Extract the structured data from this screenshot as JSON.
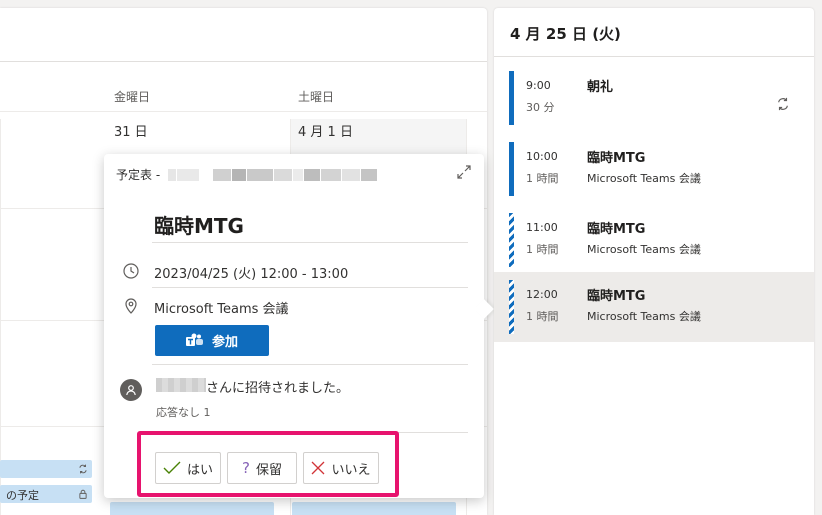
{
  "calendar": {
    "day_headers": [
      "金曜日",
      "土曜日"
    ],
    "dates": [
      "31 日",
      "4 月 1 日"
    ],
    "chip_label": "の予定"
  },
  "popup": {
    "header_label": "予定表 -",
    "title": "臨時MTG",
    "datetime": "2023/04/25 (火) 12:00 - 13:00",
    "location": "Microsoft Teams 会議",
    "join_label": "参加",
    "invite_text": "さんに招待されました。",
    "response_summary": "応答なし 1",
    "buttons": {
      "yes": "はい",
      "maybe": "保留",
      "no": "いいえ"
    },
    "colors": {
      "accent": "#0f6cbd",
      "highlight": "#e7136e"
    }
  },
  "agenda": {
    "date_heading": "4 月 25 日 (火)",
    "events": [
      {
        "time": "9:00",
        "duration": "30 分",
        "title": "朝礼",
        "location": "",
        "style": "solid",
        "recurring": true,
        "selected": false
      },
      {
        "time": "10:00",
        "duration": "1 時間",
        "title": "臨時MTG",
        "location": "Microsoft Teams 会議",
        "style": "solid",
        "recurring": false,
        "selected": false
      },
      {
        "time": "11:00",
        "duration": "1 時間",
        "title": "臨時MTG",
        "location": "Microsoft Teams 会議",
        "style": "tentative",
        "recurring": false,
        "selected": false
      },
      {
        "time": "12:00",
        "duration": "1 時間",
        "title": "臨時MTG",
        "location": "Microsoft Teams 会議",
        "style": "tentative",
        "recurring": false,
        "selected": true
      }
    ]
  }
}
